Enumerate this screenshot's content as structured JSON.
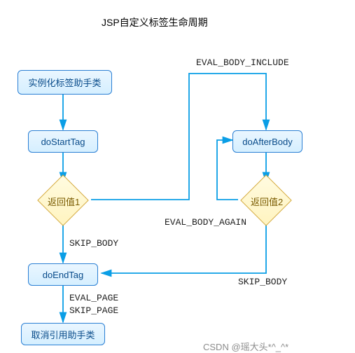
{
  "title": "JSP自定义标签生命周期",
  "nodes": {
    "instantiate": "实例化标签助手类",
    "doStartTag": "doStartTag",
    "doAfterBody": "doAfterBody",
    "doEndTag": "doEndTag",
    "release": "取消引用助手类"
  },
  "decisions": {
    "ret1": "返回值1",
    "ret2": "返回值2"
  },
  "edge_labels": {
    "eval_body_include": "EVAL_BODY_INCLUDE",
    "eval_body_again": "EVAL_BODY_AGAIN",
    "skip_body_1": "SKIP_BODY",
    "skip_body_2": "SKIP_BODY",
    "eval_page": "EVAL_PAGE",
    "skip_page": "SKIP_PAGE"
  },
  "watermark": "CSDN @瑶大头*^_^*",
  "colors": {
    "arrow": "#0a9ee6",
    "node_border": "#2a7fd4",
    "diamond_border": "#d4a93a"
  }
}
